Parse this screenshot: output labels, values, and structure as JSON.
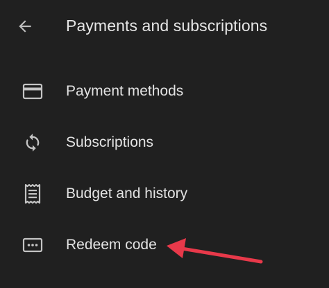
{
  "header": {
    "title": "Payments and subscriptions",
    "back_icon": "arrow-back-icon"
  },
  "menu": {
    "items": [
      {
        "label": "Payment methods",
        "icon": "credit-card-icon"
      },
      {
        "label": "Subscriptions",
        "icon": "sync-icon"
      },
      {
        "label": "Budget and history",
        "icon": "receipt-icon"
      },
      {
        "label": "Redeem code",
        "icon": "redeem-code-icon"
      }
    ]
  },
  "colors": {
    "background": "#202020",
    "text": "#e3e3e3",
    "icon": "#c4c4c4",
    "annotation_arrow": "#e8394a"
  }
}
